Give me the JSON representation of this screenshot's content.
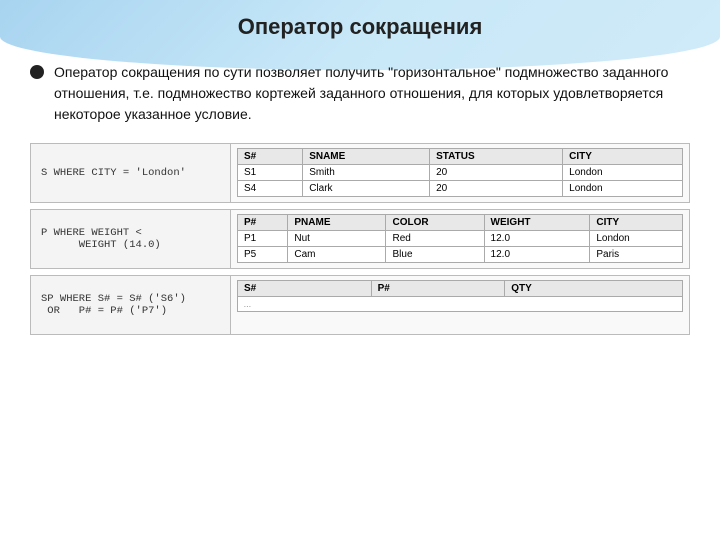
{
  "header": {
    "title": "Оператор сокращения"
  },
  "bullet": {
    "text": "Оператор сокращения по сути позволяет получить \"горизонтальное\" подмножество заданного отношения, т.е. подмножество кортежей заданного отношения, для которых удовлетворяется некоторое указанное условие."
  },
  "blocks": [
    {
      "query": "S WHERE CITY = 'London'",
      "table": {
        "headers": [
          "S#",
          "SNAME",
          "STATUS",
          "CITY"
        ],
        "rows": [
          [
            "S1",
            "Smith",
            "20",
            "London"
          ],
          [
            "S4",
            "Clark",
            "20",
            "London"
          ]
        ]
      }
    },
    {
      "query": "P WHERE WEIGHT <\n      WEIGHT (14.0)",
      "table": {
        "headers": [
          "P#",
          "PNAME",
          "COLOR",
          "WEIGHT",
          "CITY"
        ],
        "rows": [
          [
            "P1",
            "Nut",
            "Red",
            "12.0",
            "London"
          ],
          [
            "P5",
            "Cam",
            "Blue",
            "12.0",
            "Paris"
          ]
        ]
      }
    },
    {
      "query": "SP WHERE S# = S# ('S6')\n OR   P# = P# ('P7')",
      "table": {
        "headers": [
          "S#",
          "P#",
          "QTY"
        ],
        "rows": []
      }
    }
  ]
}
